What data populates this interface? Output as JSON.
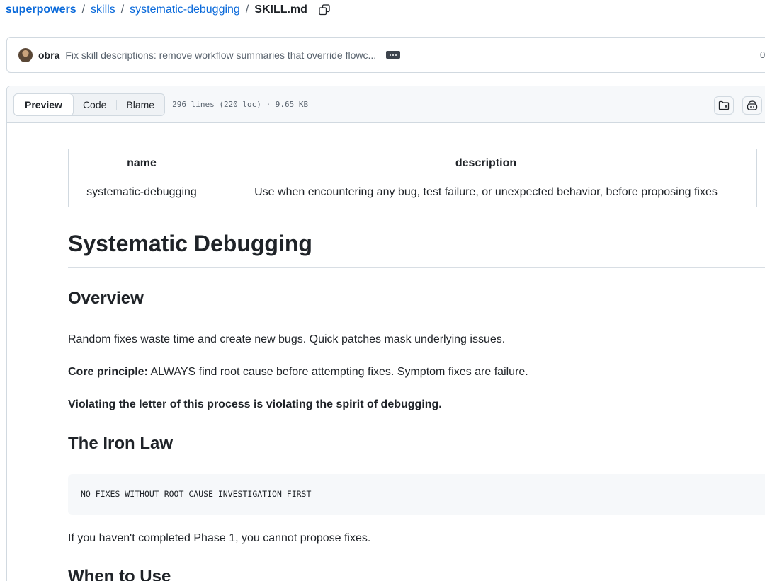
{
  "breadcrumb": {
    "items": [
      "superpowers",
      "skills",
      "systematic-debugging"
    ],
    "separator": "/",
    "current": "SKILL.md"
  },
  "commit": {
    "author": "obra",
    "message": "Fix skill descriptions: remove workflow summaries that override flowc...",
    "time": "0"
  },
  "file_header": {
    "tabs": [
      "Preview",
      "Code",
      "Blame"
    ],
    "active_tab": "Preview",
    "meta": "296 lines (220 loc) · 9.65 KB"
  },
  "frontmatter": {
    "headers": [
      "name",
      "description"
    ],
    "row": [
      "systematic-debugging",
      "Use when encountering any bug, test failure, or unexpected behavior, before proposing fixes"
    ]
  },
  "doc": {
    "title": "Systematic Debugging",
    "overview_heading": "Overview",
    "overview_p1": "Random fixes waste time and create new bugs. Quick patches mask underlying issues.",
    "core_label": "Core principle:",
    "core_text": " ALWAYS find root cause before attempting fixes. Symptom fixes are failure.",
    "violating": "Violating the letter of this process is violating the spirit of debugging.",
    "iron_law_heading": "The Iron Law",
    "iron_law_code": "NO FIXES WITHOUT ROOT CAUSE INVESTIGATION FIRST",
    "phase_text": "If you haven't completed Phase 1, you cannot propose fixes.",
    "when_heading": "When to Use"
  },
  "icons": {
    "copy": "copy-icon",
    "more": "kebab-horizontal-icon",
    "open_dir": "file-directory-open-icon",
    "copilot": "copilot-icon"
  },
  "colors": {
    "link": "#0969da",
    "text": "#1f2328",
    "muted": "#59636e",
    "border": "#d1d9e0"
  }
}
